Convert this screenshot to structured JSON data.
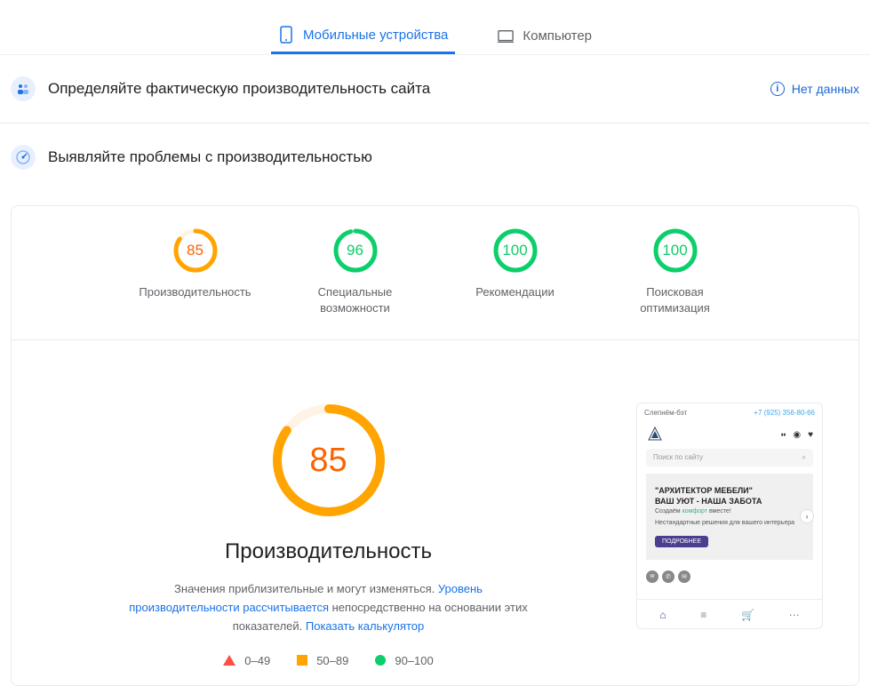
{
  "tabs": {
    "mobile": "Мобильные устройства",
    "desktop": "Компьютер"
  },
  "section1": {
    "title": "Определяйте фактическую производительность сайта",
    "no_data": "Нет данных"
  },
  "section2": {
    "title": "Выявляйте проблемы с производительностью"
  },
  "gauges": [
    {
      "score": "85",
      "label": "Производительность",
      "color": "orange",
      "percent": 85
    },
    {
      "score": "96",
      "label": "Специальные возможности",
      "color": "green",
      "percent": 96
    },
    {
      "score": "100",
      "label": "Рекомендации",
      "color": "green",
      "percent": 100
    },
    {
      "score": "100",
      "label": "Поисковая оптимизация",
      "color": "green",
      "percent": 100
    }
  ],
  "performance": {
    "score": "85",
    "title": "Производительность",
    "desc_pre": "Значения приблизительные и могут изменяться. ",
    "link1": "Уровень производительности рассчитывается",
    "desc_mid": " непосредственно на основании этих показателей. ",
    "link2": "Показать калькулятор"
  },
  "legend": {
    "poor": "0–49",
    "ok": "50–89",
    "good": "90–100"
  },
  "preview": {
    "location": "Слепнём-бэт",
    "phone": "+7 (925) 356-80-66",
    "search": "Поиск по сайту",
    "hero_title1": "\"АРХИТЕКТОР МЕБЕЛИ\"",
    "hero_title2": "ВАШ УЮТ - НАША ЗАБОТА",
    "hero_create": "Создаём ",
    "hero_comfort": "комфорт",
    "hero_together": " вместе!",
    "hero_sub": "Нестандартные решения для вашего интерьера",
    "hero_btn": "ПОДРОБНЕЕ"
  }
}
